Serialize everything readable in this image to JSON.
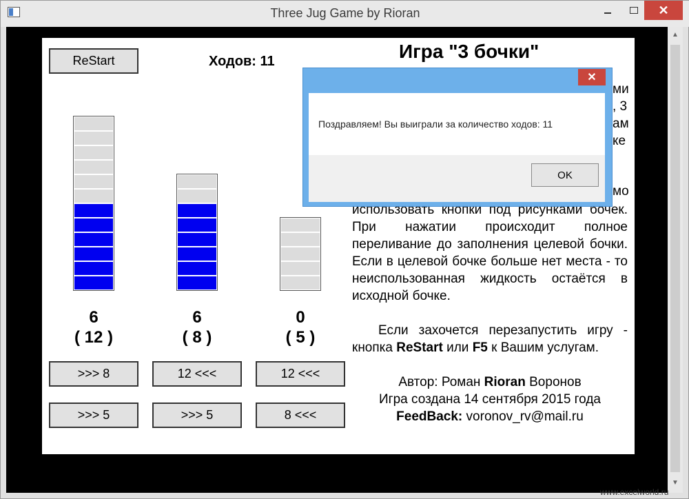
{
  "window": {
    "title": "Three Jug Game by Rioran"
  },
  "toolbar": {
    "restart_label": "ReStart",
    "moves_label": "Ходов: 11"
  },
  "game": {
    "title": "Игра \"3 бочки\""
  },
  "jugs": [
    {
      "amount": "6",
      "capacity": "( 12 )",
      "fill_units": 6,
      "capacity_units": 12
    },
    {
      "amount": "6",
      "capacity": "( 8 )",
      "fill_units": 6,
      "capacity_units": 8
    },
    {
      "amount": "0",
      "capacity": "( 5 )",
      "fill_units": 0,
      "capacity_units": 5
    }
  ],
  "buttons": {
    "row1": [
      ">>> 8",
      "12 <<<",
      "12 <<<"
    ],
    "row2": [
      ">>> 5",
      ">>> 5",
      "8 <<<"
    ]
  },
  "rules_partial": {
    "line1_end": "ми",
    "line2_end": ", 3",
    "line3_end": "ам",
    "line4_end": "ке",
    "line5_end": "мо"
  },
  "rules": {
    "p1": "использовать кнопки под рисунками бочек. При нажатии происходит полное переливание до заполнения целевой бочки. Если в целевой бочке больше нет места - то неиспользованная жидкость остаётся в исходной бочке.",
    "p2_pre": "Если захочется перезапустить игру - кнопка ",
    "p2_restart": "ReStart",
    "p2_mid": " или ",
    "p2_f5": "F5",
    "p2_post": " к Вашим услугам.",
    "author_pre": "Автор: Роман ",
    "author_nick": "Rioran",
    "author_post": " Воронов",
    "created": "Игра создана 14 сентября 2015 года",
    "feedback_label": "FeedBack:",
    "feedback_email": " voronov_rv@mail.ru"
  },
  "dialog": {
    "message": "Поздравляем! Вы выиграли за количество ходов: 11",
    "ok_label": "OK",
    "close_glyph": "✕"
  },
  "watermark": "www.excelworld.ru",
  "colors": {
    "water": "#0000f0",
    "empty": "#dcdcdc",
    "dialog_frame": "#6db0ea",
    "close_red": "#c9463d"
  }
}
